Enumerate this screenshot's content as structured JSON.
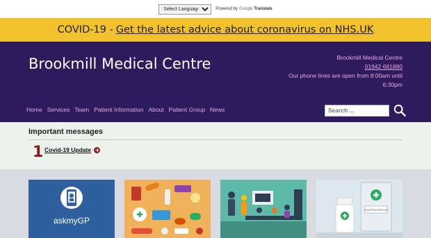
{
  "translate": {
    "select_label": "Select Language",
    "powered_by": "Powered by",
    "google": "Google",
    "translate": "Translate"
  },
  "banner": {
    "prefix": "COVID-19 -",
    "link": "Get the latest advice about coronavirus on NHS.UK",
    "color": "#f2c12e"
  },
  "header": {
    "title": "Brookmill Medical Centre",
    "contact_name": "Brookmill Medical Centre",
    "phone": "01942 681880",
    "hours": "Our phone lines are open from 8:00am until 6:30pm",
    "bg_color": "#2e1b5e",
    "link_color": "#e8a8dc"
  },
  "nav": {
    "items": [
      "Home",
      "Services",
      "Team",
      "Patient Information",
      "About",
      "Patient Group",
      "News"
    ]
  },
  "search": {
    "placeholder": "Search ...",
    "icon": "search-icon"
  },
  "messages": {
    "heading": "Important messages",
    "count": "1",
    "link": "Covid-19 Update",
    "icon": "arrow-circle-right-icon"
  },
  "cards": [
    {
      "image": "askmygp-image",
      "logo_text": "askmyGP"
    },
    {
      "image": "medication-image"
    },
    {
      "image": "meeting-image"
    },
    {
      "image": "pharmacy-image",
      "box_label": "YOUR PRESCRIPTION"
    }
  ]
}
